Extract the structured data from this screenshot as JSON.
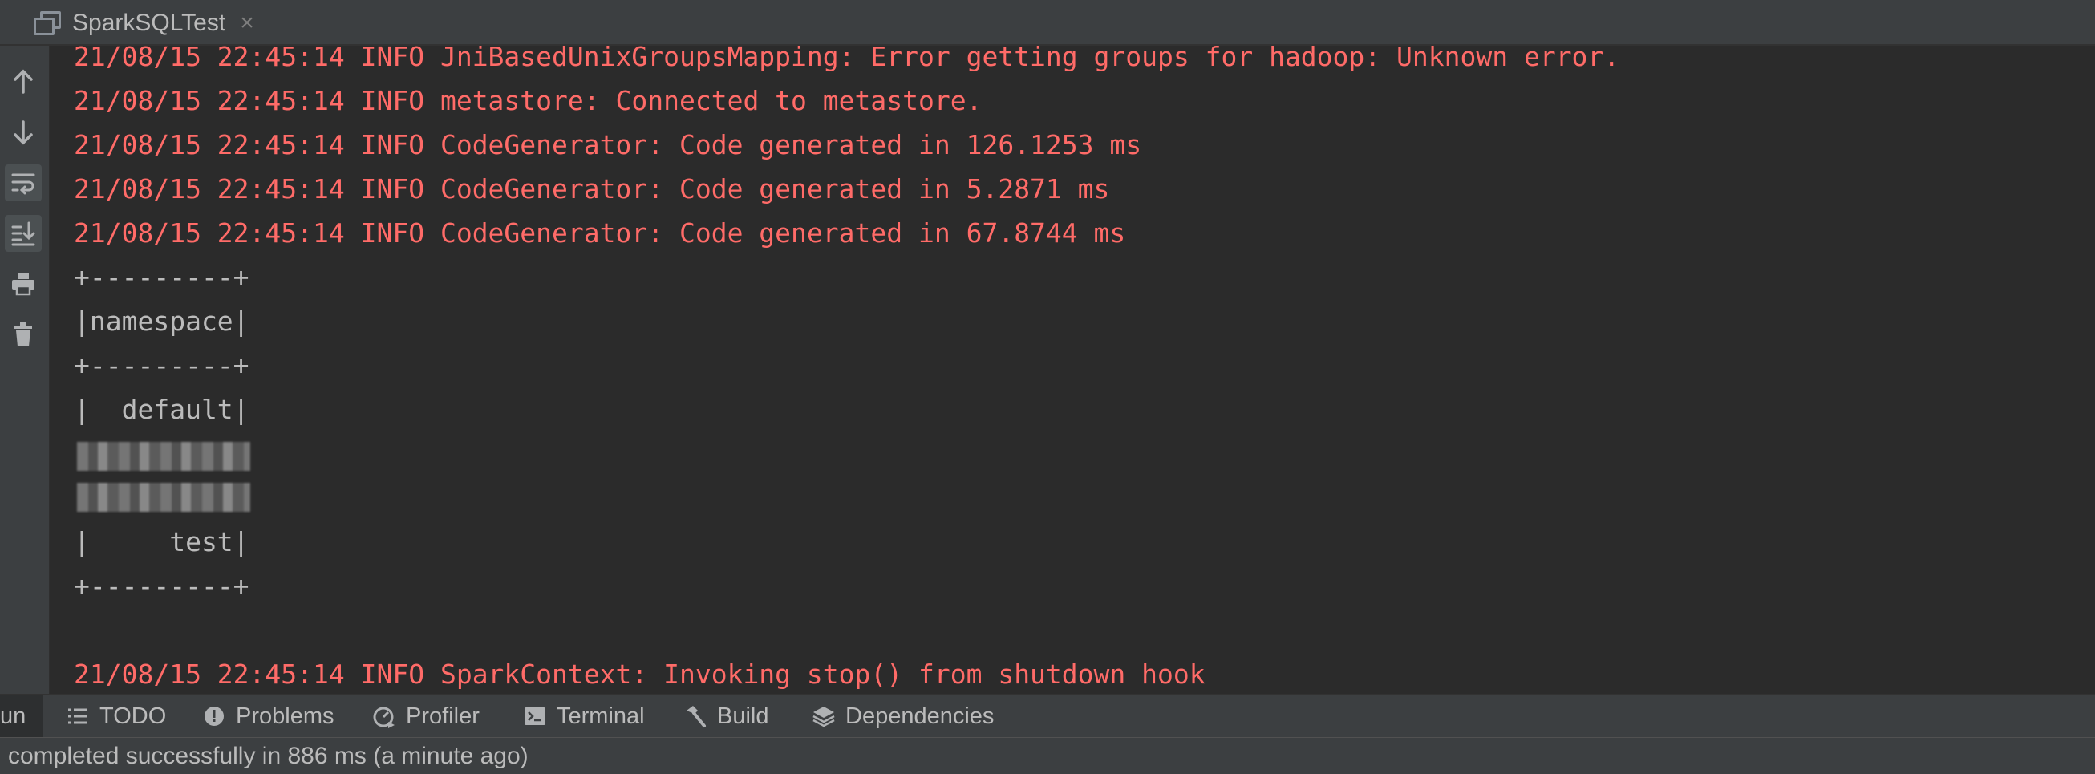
{
  "tab": {
    "title": "SparkSQLTest",
    "close": "×"
  },
  "toolbar_icons": [
    "up-arrow-icon",
    "down-arrow-icon",
    "soft-wrap-icon",
    "scroll-to-end-icon",
    "print-icon",
    "trash-icon"
  ],
  "console": {
    "lines": [
      {
        "text": "21/08/15 22:45:14 INFO JniBasedUnixGroupsMapping: Error getting groups for hadoop: Unknown error.",
        "kind": "err"
      },
      {
        "text": "21/08/15 22:45:14 INFO metastore: Connected to metastore.",
        "kind": "err"
      },
      {
        "text": "21/08/15 22:45:14 INFO CodeGenerator: Code generated in 126.1253 ms",
        "kind": "err"
      },
      {
        "text": "21/08/15 22:45:14 INFO CodeGenerator: Code generated in 5.2871 ms",
        "kind": "err"
      },
      {
        "text": "21/08/15 22:45:14 INFO CodeGenerator: Code generated in 67.8744 ms",
        "kind": "err"
      },
      {
        "text": "+---------+",
        "kind": "out"
      },
      {
        "text": "|namespace|",
        "kind": "out"
      },
      {
        "text": "+---------+",
        "kind": "out"
      },
      {
        "text": "|  default|",
        "kind": "out"
      },
      {
        "text": "|     test|",
        "kind": "out"
      },
      {
        "text": "+---------+",
        "kind": "out"
      },
      {
        "text": "21/08/15 22:45:14 INFO SparkContext: Invoking stop() from shutdown hook",
        "kind": "err"
      }
    ]
  },
  "bottom_tabs": [
    {
      "label": "un"
    },
    {
      "label": "TODO",
      "icon": "list-icon"
    },
    {
      "label": "Problems",
      "icon": "problems-icon"
    },
    {
      "label": "Profiler",
      "icon": "profiler-icon"
    },
    {
      "label": "Terminal",
      "icon": "terminal-icon"
    },
    {
      "label": "Build",
      "icon": "hammer-icon"
    },
    {
      "label": "Dependencies",
      "icon": "layers-icon"
    }
  ],
  "status": {
    "text": "completed successfully in 886 ms (a minute ago)"
  },
  "colors": {
    "error_text": "#ff6b68",
    "normal_text": "#bbbbbb",
    "background": "#2b2b2b",
    "panel": "#3c3f41"
  }
}
